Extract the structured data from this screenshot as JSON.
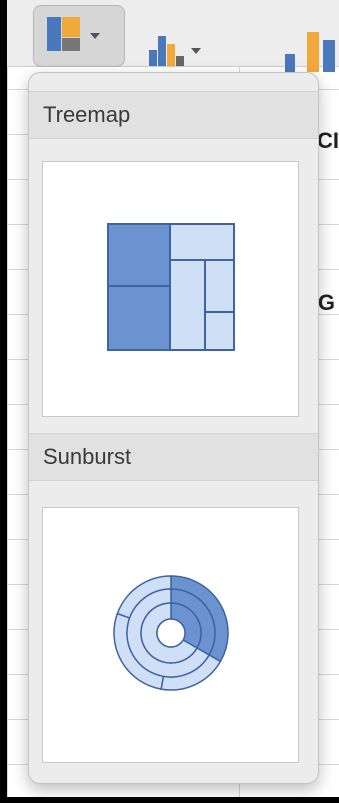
{
  "ribbon": {
    "buttons": [
      {
        "name": "hierarchy-chart-button",
        "icon": "treemap-chart-icon",
        "active": true
      },
      {
        "name": "statistic-chart-button",
        "icon": "histogram-chart-icon",
        "active": false
      },
      {
        "name": "combo-chart-button",
        "icon": "bar-chart-icon",
        "active": false
      }
    ],
    "label_fragment": "CI"
  },
  "sheet": {
    "column_letter": "G"
  },
  "menu": {
    "sections": [
      {
        "header": "Treemap",
        "item_icon": "treemap-chart-icon"
      },
      {
        "header": "Sunburst",
        "item_icon": "sunburst-chart-icon"
      }
    ]
  },
  "colors": {
    "accent_dark": "#6a93cf",
    "accent_light": "#cfe0f6",
    "stroke": "#3f63a3"
  }
}
